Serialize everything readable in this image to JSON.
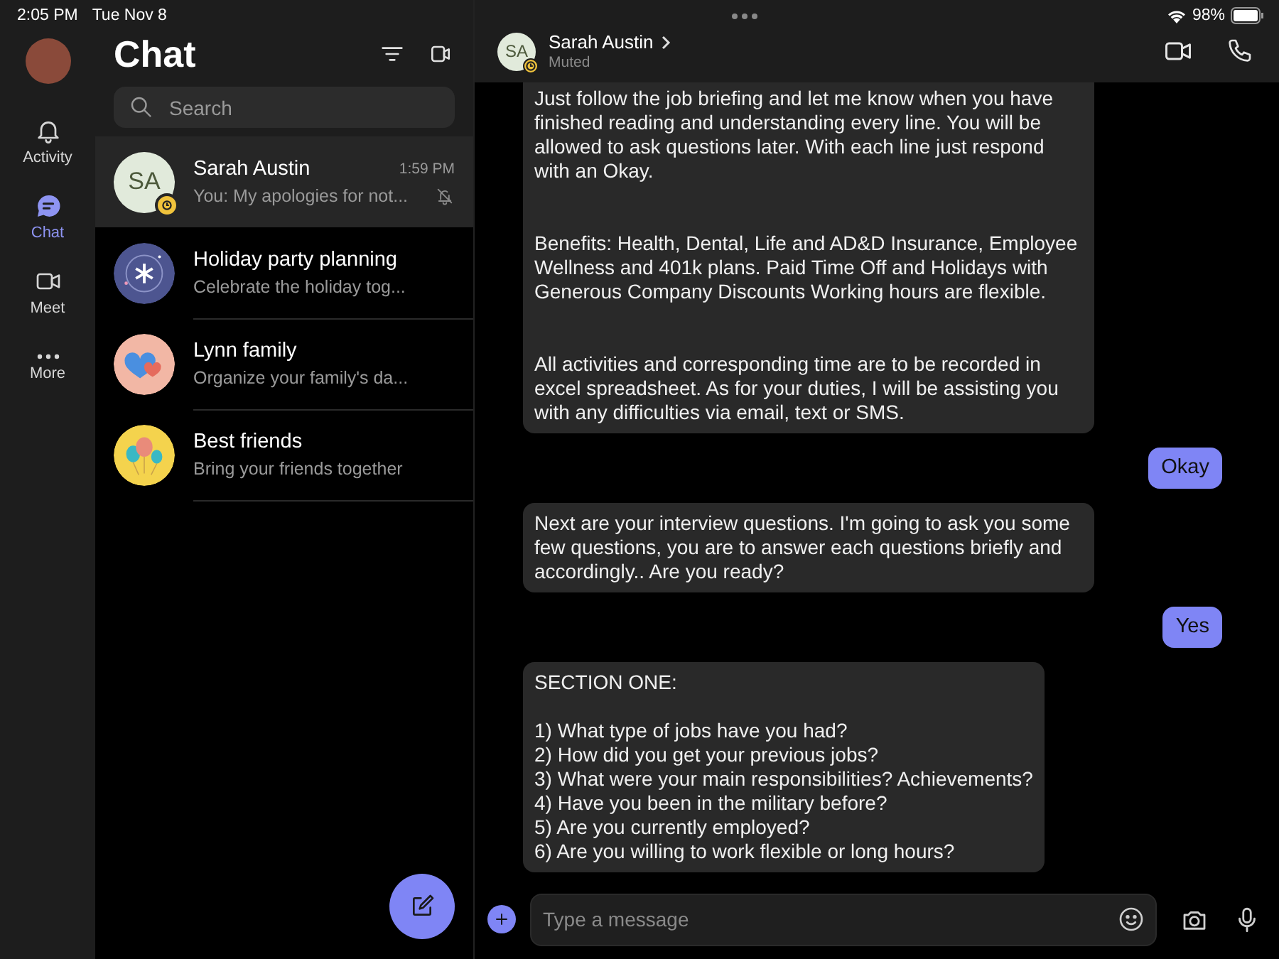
{
  "status_bar": {
    "time": "2:05 PM",
    "date": "Tue Nov 8",
    "battery": "98%"
  },
  "rail": {
    "items": [
      {
        "label": "Activity",
        "kind": "bell",
        "selected": false
      },
      {
        "label": "Chat",
        "kind": "chat",
        "selected": true
      },
      {
        "label": "Meet",
        "kind": "video",
        "selected": false
      },
      {
        "label": "More",
        "kind": "dots",
        "selected": false
      }
    ]
  },
  "chat_list": {
    "title": "Chat",
    "search": {
      "placeholder": "Search"
    },
    "chats": [
      {
        "name": "Sarah Austin",
        "preview": "You: My apologies for not...",
        "time": "1:59 PM",
        "kind": "initials",
        "initials": "SA",
        "away": true,
        "muted": true,
        "selected": true
      },
      {
        "name": "Holiday party planning",
        "preview": "Celebrate the holiday tog...",
        "kind": "snowflake",
        "away": false,
        "muted": false,
        "selected": false
      },
      {
        "name": "Lynn family",
        "preview": "Organize your family's da...",
        "kind": "hearts",
        "away": false,
        "muted": false,
        "selected": false
      },
      {
        "name": "Best friends",
        "preview": "Bring your friends together",
        "kind": "balloons",
        "away": false,
        "muted": false,
        "selected": false
      }
    ]
  },
  "conversation": {
    "name": "Sarah Austin",
    "initials": "SA",
    "away": true,
    "status": "Muted",
    "messages": [
      {
        "kind": "received",
        "text": "Just follow the job briefing and let me know when you have finished reading and understanding every line. You will be allowed to ask questions later. With each line just respond with an Okay.\n\n\nBenefits: Health, Dental, Life and AD&D Insurance, Employee Wellness and 401k plans. Paid Time Off and Holidays with Generous Company Discounts Working hours are flexible.\n\n\nAll activities and corresponding time are to be recorded in excel spreadsheet. As for your duties, I will be assisting you with any difficulties via email, text or SMS."
      },
      {
        "kind": "sent",
        "text": "Okay"
      },
      {
        "kind": "received",
        "text": "Next are your interview questions. I'm going to ask you some few questions, you are to answer each questions briefly and accordingly.. Are you ready?"
      },
      {
        "kind": "sent",
        "text": "Yes"
      },
      {
        "kind": "received",
        "text": "SECTION ONE:\n\n1) What type of jobs have you had?\n2) How did you get your previous jobs?\n3) What were your main responsibilities? Achievements?\n4) Have you been in the military before?\n5) Are you currently employed?\n6) Are you willing to work flexible or long hours?"
      }
    ],
    "composer": {
      "placeholder": "Type a message"
    }
  }
}
